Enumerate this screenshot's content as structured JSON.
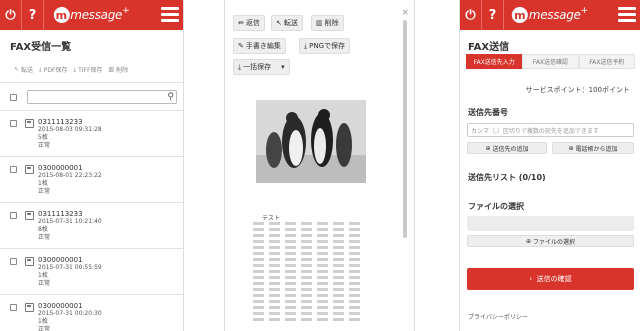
{
  "header": {
    "logo_m": "m",
    "logo_text": "message",
    "logo_plus": "+"
  },
  "inbox": {
    "title": "FAX受信一覧",
    "toolbar": [
      {
        "label": "転送",
        "icon": "forward-icon"
      },
      {
        "label": "PDF保存",
        "icon": "download-icon"
      },
      {
        "label": "TIFF保存",
        "icon": "download-icon"
      },
      {
        "label": "削除",
        "icon": "trash-icon"
      }
    ],
    "items": [
      {
        "number": "0311113233",
        "datetime": "2015-08-03 09:31:28",
        "pages": "5枚",
        "status": "正常"
      },
      {
        "number": "0300000001",
        "datetime": "2015-08-01 22:23:22",
        "pages": "1枚",
        "status": "正常"
      },
      {
        "number": "0311113233",
        "datetime": "2015-07-31 10:21:40",
        "pages": "8枚",
        "status": "正常"
      },
      {
        "number": "0300000001",
        "datetime": "2015-07-31 00:55:59",
        "pages": "1枚",
        "status": "正常"
      },
      {
        "number": "0300000001",
        "datetime": "2015-07-31 00:20:30",
        "pages": "1枚",
        "status": "正常"
      }
    ]
  },
  "viewer": {
    "reply_label": "返信",
    "forward_label": "転送",
    "delete_label": "削除",
    "handwrite_label": "手書き編集",
    "png_label": "PNGで保存",
    "bulk_save_label": "一括保存",
    "close_label": "×",
    "doc_text": "テスト"
  },
  "send": {
    "title": "FAX送信",
    "steps": [
      "FAX送信先入力",
      "FAX送信確認",
      "FAX送信予約"
    ],
    "points": "サービスポイント：100ポイント",
    "dest_heading": "送信先番号",
    "dest_placeholder": "カンマ（,）区切りで複数の宛先を追加できます",
    "add_dest_label": "送信先の追加",
    "add_phonebook_label": "電話帳から追加",
    "list_heading": "送信先リスト (0/10)",
    "file_heading": "ファイルの選択",
    "file_select_label": "ファイルの選択",
    "submit_label": "送信の確認",
    "privacy_label": "プライバシーポリシー"
  },
  "colors": {
    "brand_red": "#d9342b"
  }
}
